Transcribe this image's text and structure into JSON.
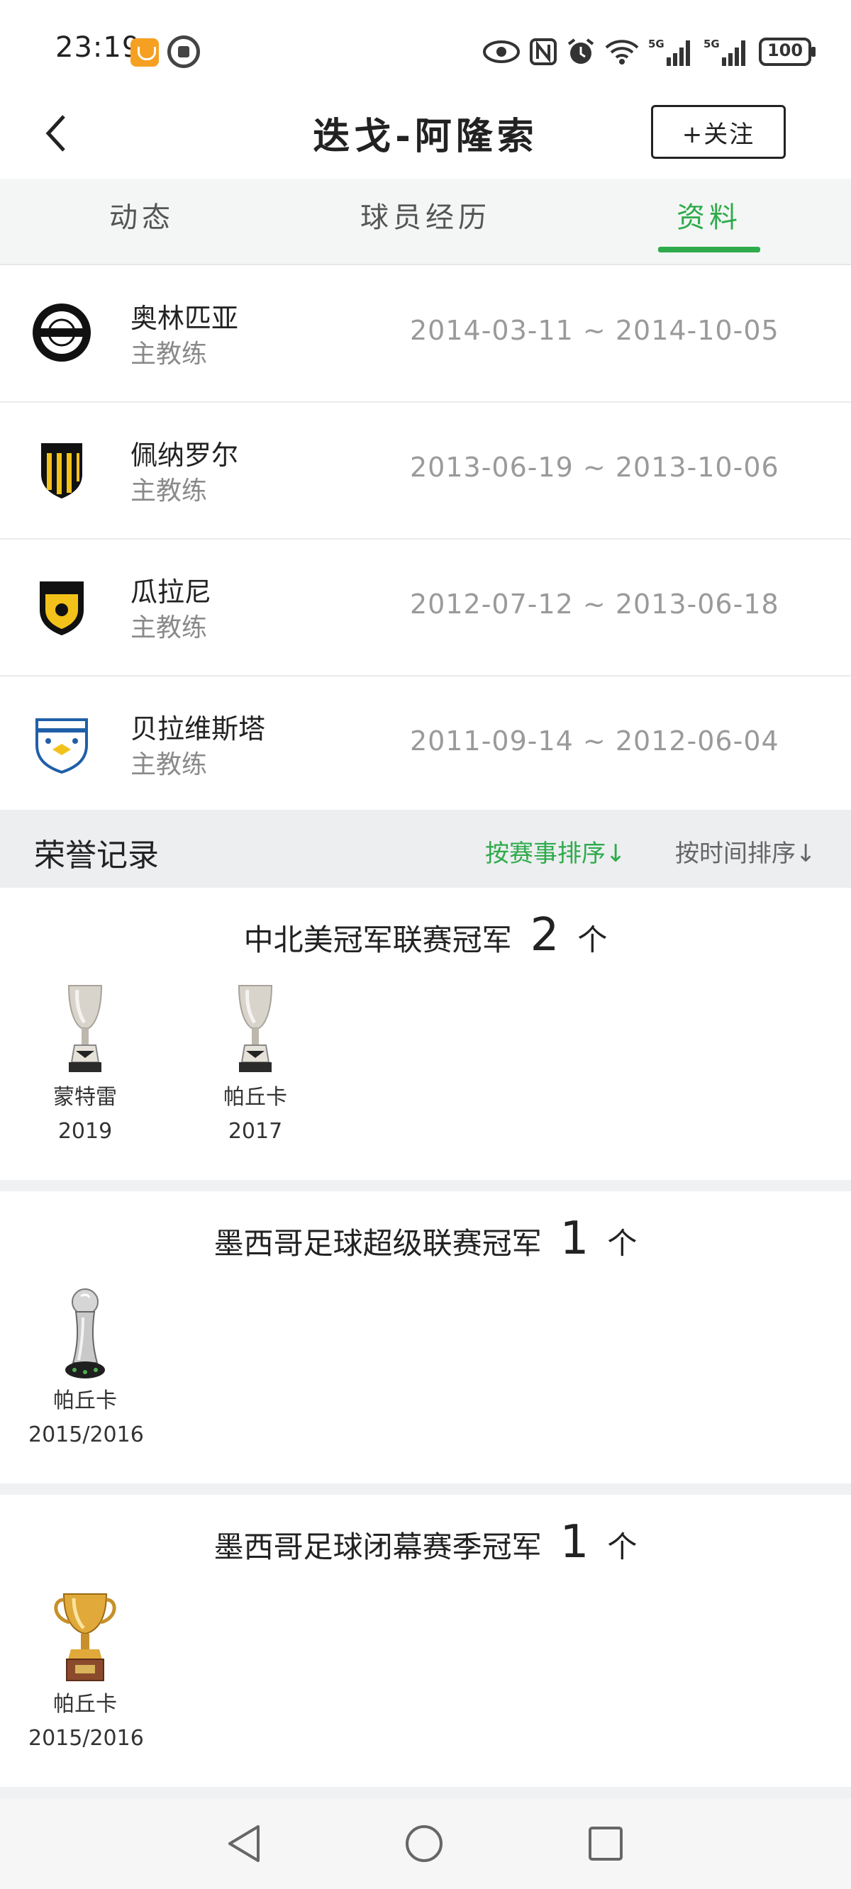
{
  "status_bar": {
    "time": "23:19",
    "battery": "100"
  },
  "header": {
    "title": "迭戈-阿隆索",
    "follow_label": "+关注"
  },
  "tabs": [
    {
      "label": "动态",
      "active": false
    },
    {
      "label": "球员经历",
      "active": false
    },
    {
      "label": "资料",
      "active": true
    }
  ],
  "career": [
    {
      "club": "奥林匹亚",
      "role": "主教练",
      "dates": "2014-03-11 ~ 2014-10-05",
      "crest": "olimpia-crest"
    },
    {
      "club": "佩纳罗尔",
      "role": "主教练",
      "dates": "2013-06-19 ~ 2013-10-06",
      "crest": "penarol-crest"
    },
    {
      "club": "瓜拉尼",
      "role": "主教练",
      "dates": "2012-07-12 ~ 2013-06-18",
      "crest": "guarani-crest"
    },
    {
      "club": "贝拉维斯塔",
      "role": "主教练",
      "dates": "2011-09-14 ~ 2012-06-04",
      "crest": "bella-vista-crest"
    }
  ],
  "honours": {
    "title": "荣誉记录",
    "sort_by_competition": "按赛事排序↓",
    "sort_by_time": "按时间排序↓",
    "sections": [
      {
        "name": "中北美冠军联赛冠军",
        "count": "2",
        "unit": "个",
        "items": [
          {
            "team": "蒙特雷",
            "year": "2019"
          },
          {
            "team": "帕丘卡",
            "year": "2017"
          }
        ]
      },
      {
        "name": "墨西哥足球超级联赛冠军",
        "count": "1",
        "unit": "个",
        "items": [
          {
            "team": "帕丘卡",
            "year": "2015/2016"
          }
        ]
      },
      {
        "name": "墨西哥足球闭幕赛季冠军",
        "count": "1",
        "unit": "个",
        "items": [
          {
            "team": "帕丘卡",
            "year": "2015/2016"
          }
        ]
      }
    ]
  },
  "colors": {
    "accent": "#2eab4b"
  }
}
